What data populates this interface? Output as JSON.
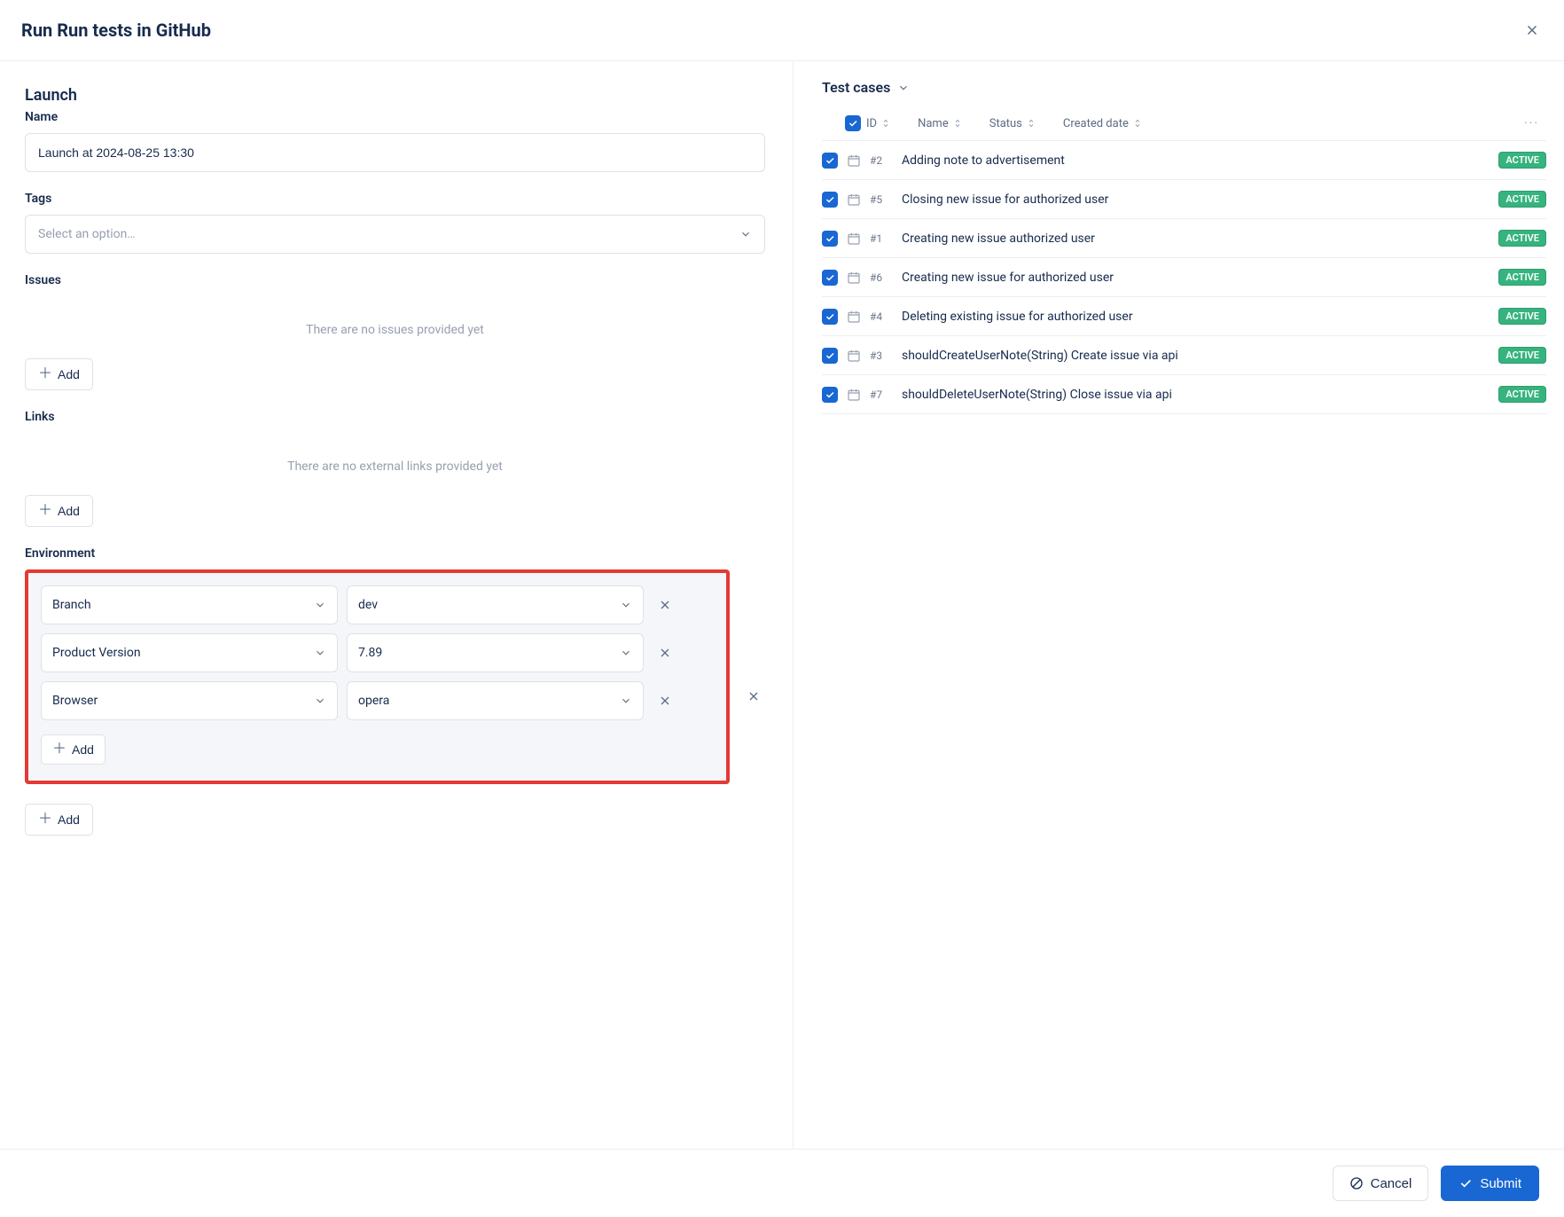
{
  "header": {
    "title": "Run Run tests in GitHub"
  },
  "launch": {
    "section": "Launch",
    "nameLabel": "Name",
    "nameValue": "Launch at 2024-08-25 13:30",
    "tagsLabel": "Tags",
    "tagsPlaceholder": "Select an option…",
    "issuesLabel": "Issues",
    "issuesEmpty": "There are no issues provided yet",
    "linksLabel": "Links",
    "linksEmpty": "There are no external links provided yet",
    "envLabel": "Environment",
    "addLabel": "Add"
  },
  "env": [
    {
      "key": "Branch",
      "value": "dev"
    },
    {
      "key": "Product Version",
      "value": "7.89"
    },
    {
      "key": "Browser",
      "value": "opera"
    }
  ],
  "testcases": {
    "title": "Test cases",
    "columns": {
      "id": "ID",
      "name": "Name",
      "status": "Status",
      "created": "Created date"
    },
    "rows": [
      {
        "id": "#2",
        "name": "Adding note to advertisement",
        "status": "ACTIVE"
      },
      {
        "id": "#5",
        "name": "Closing new issue for authorized user",
        "status": "ACTIVE"
      },
      {
        "id": "#1",
        "name": "Creating new issue authorized user",
        "status": "ACTIVE"
      },
      {
        "id": "#6",
        "name": "Creating new issue for authorized user",
        "status": "ACTIVE"
      },
      {
        "id": "#4",
        "name": "Deleting existing issue for authorized user",
        "status": "ACTIVE"
      },
      {
        "id": "#3",
        "name": "shouldCreateUserNote(String) Create issue via api",
        "status": "ACTIVE"
      },
      {
        "id": "#7",
        "name": "shouldDeleteUserNote(String) Close issue via api",
        "status": "ACTIVE"
      }
    ]
  },
  "footer": {
    "cancel": "Cancel",
    "submit": "Submit"
  }
}
